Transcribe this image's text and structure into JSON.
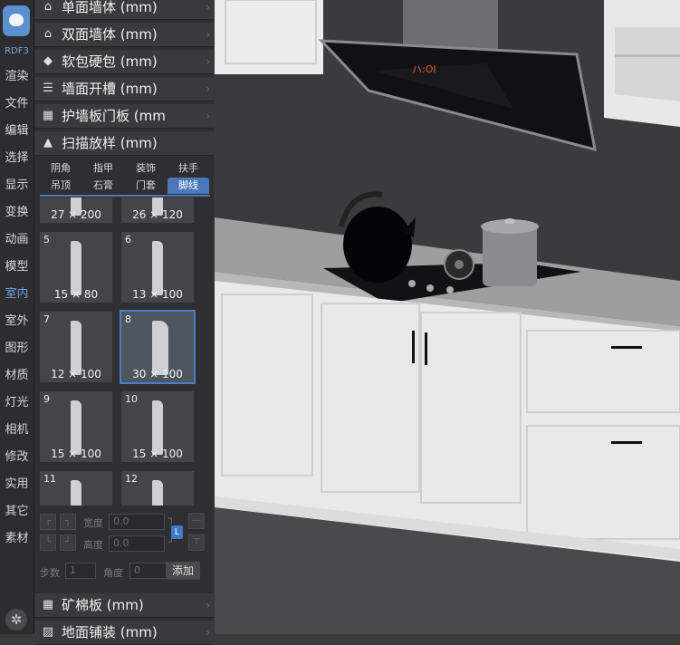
{
  "nav": {
    "brand": "RDF3",
    "items": [
      "渲染",
      "文件",
      "编辑",
      "选择",
      "显示",
      "变换",
      "动画",
      "模型",
      "室内",
      "室外",
      "图形",
      "材质",
      "灯光",
      "相机",
      "修改",
      "实用",
      "其它",
      "素材"
    ],
    "active_index": 8
  },
  "panel": {
    "sections_top": [
      {
        "label": "单面墙体 (mm)",
        "icon": "home-outline-icon"
      },
      {
        "label": "双面墙体 (mm)",
        "icon": "home-filled-icon"
      },
      {
        "label": "软包硬包 (mm)",
        "icon": "diamond-icon"
      },
      {
        "label": "墙面开槽 (mm)",
        "icon": "bars-icon"
      },
      {
        "label": "护墙板门板 (mm",
        "icon": "panel-grid-icon"
      },
      {
        "label": "扫描放样 (mm)",
        "icon": "arrow-up-icon"
      }
    ],
    "tabs_row1": [
      "阴角",
      "指甲",
      "装饰",
      "扶手"
    ],
    "tabs_row2": [
      "吊顶",
      "石膏",
      "门套",
      "脚线"
    ],
    "selected_tab": "脚线",
    "cells": [
      {
        "no": "",
        "size": "27 × 200"
      },
      {
        "no": "",
        "size": "26 × 120"
      },
      {
        "no": "5",
        "size": "15 × 80"
      },
      {
        "no": "6",
        "size": "13 × 100"
      },
      {
        "no": "7",
        "size": "12 × 100"
      },
      {
        "no": "8",
        "size": "30 × 100",
        "selected": true
      },
      {
        "no": "9",
        "size": "15 × 100"
      },
      {
        "no": "10",
        "size": "15 × 100"
      },
      {
        "no": "11",
        "size": ""
      },
      {
        "no": "12",
        "size": ""
      }
    ],
    "controls": {
      "width_label": "宽度",
      "width_value": "0.0",
      "height_label": "高度",
      "height_value": "0.0",
      "lock_label": "L",
      "steps_label": "步数",
      "steps_value": "1",
      "angle_label": "角度",
      "angle_value": "0",
      "add_label": "添加"
    },
    "sections_bottom": [
      {
        "label": "矿棉板 (mm)",
        "icon": "grid-icon"
      },
      {
        "label": "地面铺装 (mm)",
        "icon": "hatch-icon"
      }
    ]
  },
  "scene": {
    "hood_display": "ハ:OI"
  }
}
